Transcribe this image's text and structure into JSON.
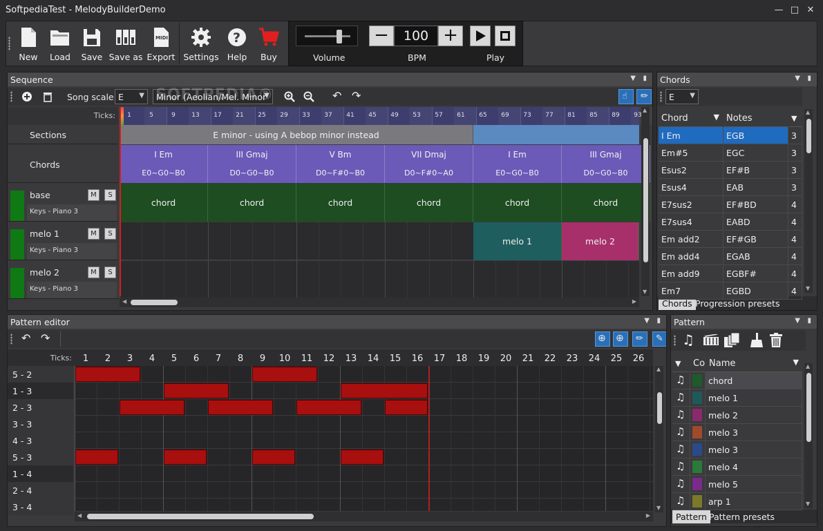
{
  "window": {
    "title": "SoftpediaTest - MelodyBuilderDemo"
  },
  "toolbar": {
    "buttons": [
      {
        "label": "New",
        "icon": "new-file-icon"
      },
      {
        "label": "Load",
        "icon": "folder-open-icon"
      },
      {
        "label": "Save",
        "icon": "floppy-disk-icon"
      },
      {
        "label": "Save as",
        "icon": "save-as-icon"
      },
      {
        "label": "Export",
        "icon": "midi-file-icon"
      },
      {
        "label": "Settings",
        "icon": "gear-icon"
      },
      {
        "label": "Help",
        "icon": "help-icon"
      },
      {
        "label": "Buy",
        "icon": "shopping-cart-icon"
      }
    ],
    "volume_label": "Volume",
    "volume_level": 0.75,
    "bpm_label": "BPM",
    "bpm_value": "100",
    "play_label": "Play",
    "accent_buy": "#e02020"
  },
  "watermark": "SOFTPEDIA®",
  "sequence": {
    "title": "Sequence",
    "song_scale_label": "Song scale:",
    "scale_key": "E",
    "scale_mode": "Minor (Aeolian/Mel. Minor",
    "ticks_label": "Ticks:",
    "ticks": [
      "1",
      "5",
      "9",
      "13",
      "17",
      "21",
      "25",
      "29",
      "33",
      "37",
      "41",
      "45",
      "49",
      "53",
      "57",
      "61",
      "65",
      "69",
      "73",
      "77",
      "81",
      "85",
      "89",
      "93"
    ],
    "sections_label": "Sections",
    "section_text": "E minor - using A bebop minor instead",
    "chords_label": "Chords",
    "chords": [
      {
        "name": "I Em",
        "notes": "E0~G0~B0"
      },
      {
        "name": "III Gmaj",
        "notes": "D0~G0~B0"
      },
      {
        "name": "V Bm",
        "notes": "D0~F#0~B0"
      },
      {
        "name": "VII Dmaj",
        "notes": "D0~F#0~A0"
      },
      {
        "name": "I Em",
        "notes": "E0~G0~B0"
      },
      {
        "name": "III Gmaj",
        "notes": "D0~G0~B0"
      }
    ],
    "tracks": [
      {
        "name": "base",
        "instrument": "Keys - Piano 3",
        "m": "M",
        "s": "S"
      },
      {
        "name": "melo 1",
        "instrument": "Keys - Piano 3",
        "m": "M",
        "s": "S"
      },
      {
        "name": "melo 2",
        "instrument": "Keys - Piano 3",
        "m": "M",
        "s": "S"
      }
    ],
    "pattern_cell_label": "chord",
    "melo1_block": "melo 1",
    "melo2_block": "melo 2"
  },
  "chords_panel": {
    "title": "Chords",
    "key": "E",
    "col_chord": "Chord",
    "col_notes": "Notes",
    "rows": [
      {
        "chord": "I Em",
        "notes": "EGB",
        "n": "3"
      },
      {
        "chord": "Em#5",
        "notes": "EGC",
        "n": "3"
      },
      {
        "chord": "Esus2",
        "notes": "EF#B",
        "n": "3"
      },
      {
        "chord": "Esus4",
        "notes": "EAB",
        "n": "3"
      },
      {
        "chord": "E7sus2",
        "notes": "EF#BD",
        "n": "4"
      },
      {
        "chord": "E7sus4",
        "notes": "EABD",
        "n": "4"
      },
      {
        "chord": "Em add2",
        "notes": "EF#GB",
        "n": "4"
      },
      {
        "chord": "Em add4",
        "notes": "EGAB",
        "n": "4"
      },
      {
        "chord": "Em add9",
        "notes": "EGBF#",
        "n": "4"
      },
      {
        "chord": "Em7",
        "notes": "EGBD",
        "n": "4"
      }
    ],
    "tabs": [
      "Chords",
      "Progression presets"
    ]
  },
  "pattern_editor": {
    "title": "Pattern editor",
    "ticks_label": "Ticks:",
    "columns": [
      "1",
      "2",
      "3",
      "4",
      "5",
      "6",
      "7",
      "8",
      "9",
      "10",
      "11",
      "12",
      "13",
      "14",
      "15",
      "16",
      "17",
      "18",
      "19",
      "20",
      "21",
      "22",
      "23",
      "24",
      "25",
      "26"
    ],
    "rows": [
      "5 - 2",
      "1 - 3",
      "2 - 3",
      "3 - 3",
      "4 - 3",
      "5 - 3",
      "1 - 4",
      "2 - 4",
      "3 - 4"
    ]
  },
  "pattern_panel": {
    "title": "Pattern",
    "col_color": "Col",
    "col_name": "Name",
    "rows": [
      {
        "name": "chord",
        "color": "#1e5a2a"
      },
      {
        "name": "melo 1",
        "color": "#1e5a5a"
      },
      {
        "name": "melo 2",
        "color": "#8a2a6a"
      },
      {
        "name": "melo 3",
        "color": "#a04a2a"
      },
      {
        "name": "melo 3",
        "color": "#2a4a8a"
      },
      {
        "name": "melo 4",
        "color": "#2a7a3a"
      },
      {
        "name": "melo 5",
        "color": "#7a2a8a"
      },
      {
        "name": "arp 1",
        "color": "#7a7a2a"
      }
    ],
    "tabs": [
      "Pattern",
      "Pattern presets"
    ]
  }
}
